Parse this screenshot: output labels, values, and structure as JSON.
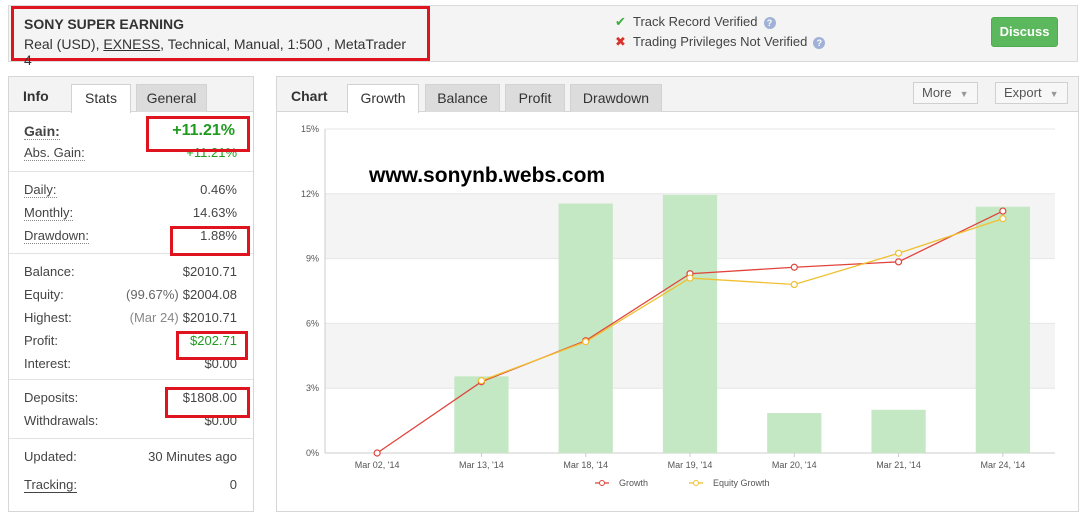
{
  "header": {
    "name": "SONY SUPER EARNING",
    "meta_prefix": "Real (USD), ",
    "broker": "EXNESS",
    "meta_suffix": ", Technical, Manual, 1:500 , MetaTrader 4",
    "track_record": "Track Record Verified",
    "trading_privileges": "Trading Privileges Not Verified",
    "discuss_label": "Discuss"
  },
  "info": {
    "title": "Info",
    "tabs": [
      "Stats",
      "General"
    ],
    "gain": {
      "label": "Gain:",
      "value": "+11.21%"
    },
    "abs_gain": {
      "label": "Abs. Gain:",
      "value": "+11.21%"
    },
    "daily": {
      "label": "Daily:",
      "value": "0.46%"
    },
    "monthly": {
      "label": "Monthly:",
      "value": "14.63%"
    },
    "drawdown": {
      "label": "Drawdown:",
      "value": "1.88%"
    },
    "balance": {
      "label": "Balance:",
      "value": "$2010.71"
    },
    "equity": {
      "label": "Equity:",
      "note": "(99.67%)",
      "value": "$2004.08"
    },
    "highest": {
      "label": "Highest:",
      "note": "(Mar 24)",
      "value": "$2010.71"
    },
    "profit": {
      "label": "Profit:",
      "value": "$202.71"
    },
    "interest": {
      "label": "Interest:",
      "value": "$0.00"
    },
    "deposits": {
      "label": "Deposits:",
      "value": "$1808.00"
    },
    "withdrawals": {
      "label": "Withdrawals:",
      "value": "$0.00"
    },
    "updated": {
      "label": "Updated:",
      "value": "30 Minutes ago"
    },
    "tracking": {
      "label": "Tracking:",
      "value": "0"
    }
  },
  "chart_panel": {
    "title": "Chart",
    "tabs": [
      "Growth",
      "Balance",
      "Profit",
      "Drawdown"
    ],
    "more_label": "More",
    "export_label": "Export",
    "watermark": "www.sonynb.webs.com"
  },
  "chart_data": {
    "type": "bar",
    "categories": [
      "Mar 02, '14",
      "Mar 13, '14",
      "Mar 18, '14",
      "Mar 19, '14",
      "Mar 20, '14",
      "Mar 21, '14",
      "Mar 24, '14"
    ],
    "ylim": [
      0,
      15
    ],
    "yticks": [
      "0%",
      "3%",
      "6%",
      "9%",
      "12%",
      "15%"
    ],
    "grid": true,
    "legend_position": "bottom",
    "bars": [
      0,
      3.55,
      11.55,
      11.95,
      1.85,
      2.0,
      11.4
    ],
    "series": [
      {
        "name": "Growth",
        "values": [
          0,
          3.3,
          5.2,
          8.3,
          8.6,
          8.85,
          11.2
        ]
      },
      {
        "name": "Equity Growth",
        "values": [
          null,
          3.35,
          5.15,
          8.1,
          7.8,
          9.25,
          10.85
        ]
      }
    ],
    "colors": {
      "bar": "#c4e7c4",
      "growth": "#e0443c",
      "equity": "#f0c030",
      "band": "#f4f4f4"
    }
  }
}
